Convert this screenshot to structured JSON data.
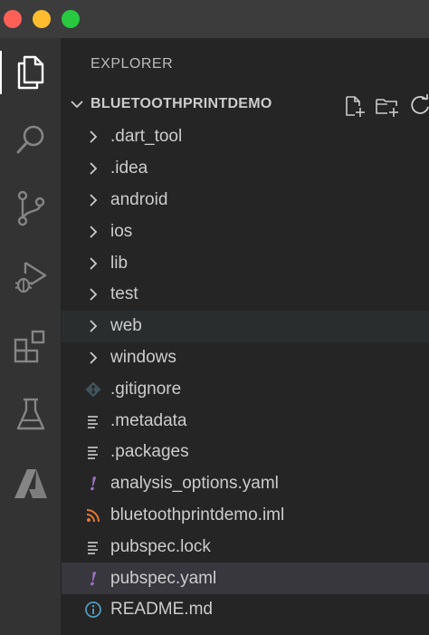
{
  "window": {
    "controls": [
      "close",
      "minimize",
      "maximize"
    ]
  },
  "activity_bar": {
    "items": [
      {
        "id": "explorer",
        "icon": "files-icon",
        "active": true
      },
      {
        "id": "search",
        "icon": "search-icon",
        "active": false
      },
      {
        "id": "source-control",
        "icon": "source-control-icon",
        "active": false
      },
      {
        "id": "run-debug",
        "icon": "run-debug-icon",
        "active": false
      },
      {
        "id": "extensions",
        "icon": "extensions-icon",
        "active": false
      },
      {
        "id": "testing",
        "icon": "flask-icon",
        "active": false
      },
      {
        "id": "azure",
        "icon": "azure-icon",
        "active": false
      }
    ]
  },
  "sidebar": {
    "title": "EXPLORER",
    "section": {
      "title": "BLUETOOTHPRINTDEMO",
      "actions": [
        "new-file-icon",
        "new-folder-icon",
        "refresh-icon"
      ]
    },
    "items": [
      {
        "label": ".dart_tool",
        "type": "folder",
        "icon": "chevron-right-icon"
      },
      {
        "label": ".idea",
        "type": "folder",
        "icon": "chevron-right-icon"
      },
      {
        "label": "android",
        "type": "folder",
        "icon": "chevron-right-icon"
      },
      {
        "label": "ios",
        "type": "folder",
        "icon": "chevron-right-icon"
      },
      {
        "label": "lib",
        "type": "folder",
        "icon": "chevron-right-icon"
      },
      {
        "label": "test",
        "type": "folder",
        "icon": "chevron-right-icon"
      },
      {
        "label": "web",
        "type": "folder",
        "icon": "chevron-right-icon",
        "state": "hover"
      },
      {
        "label": "windows",
        "type": "folder",
        "icon": "chevron-right-icon"
      },
      {
        "label": ".gitignore",
        "type": "file",
        "icon": "git-icon"
      },
      {
        "label": ".metadata",
        "type": "file",
        "icon": "lines-icon"
      },
      {
        "label": ".packages",
        "type": "file",
        "icon": "lines-icon"
      },
      {
        "label": "analysis_options.yaml",
        "type": "file",
        "icon": "yaml-icon",
        "glyph": "!"
      },
      {
        "label": "bluetoothprintdemo.iml",
        "type": "file",
        "icon": "rss-icon"
      },
      {
        "label": "pubspec.lock",
        "type": "file",
        "icon": "lines-icon"
      },
      {
        "label": "pubspec.yaml",
        "type": "file",
        "icon": "yaml-icon",
        "glyph": "!",
        "state": "selected"
      },
      {
        "label": "README.md",
        "type": "file",
        "icon": "info-icon"
      }
    ]
  },
  "colors": {
    "titlebar": "#3c3c3c",
    "activity_bar": "#333333",
    "sidebar": "#252526",
    "hover_row": "#2a2d2e",
    "selected_row": "#37373d",
    "text": "#cccccc",
    "yaml_icon": "#a074c4",
    "rss_icon": "#e37933",
    "info_icon": "#519aba",
    "git_icon": "#41535b"
  }
}
